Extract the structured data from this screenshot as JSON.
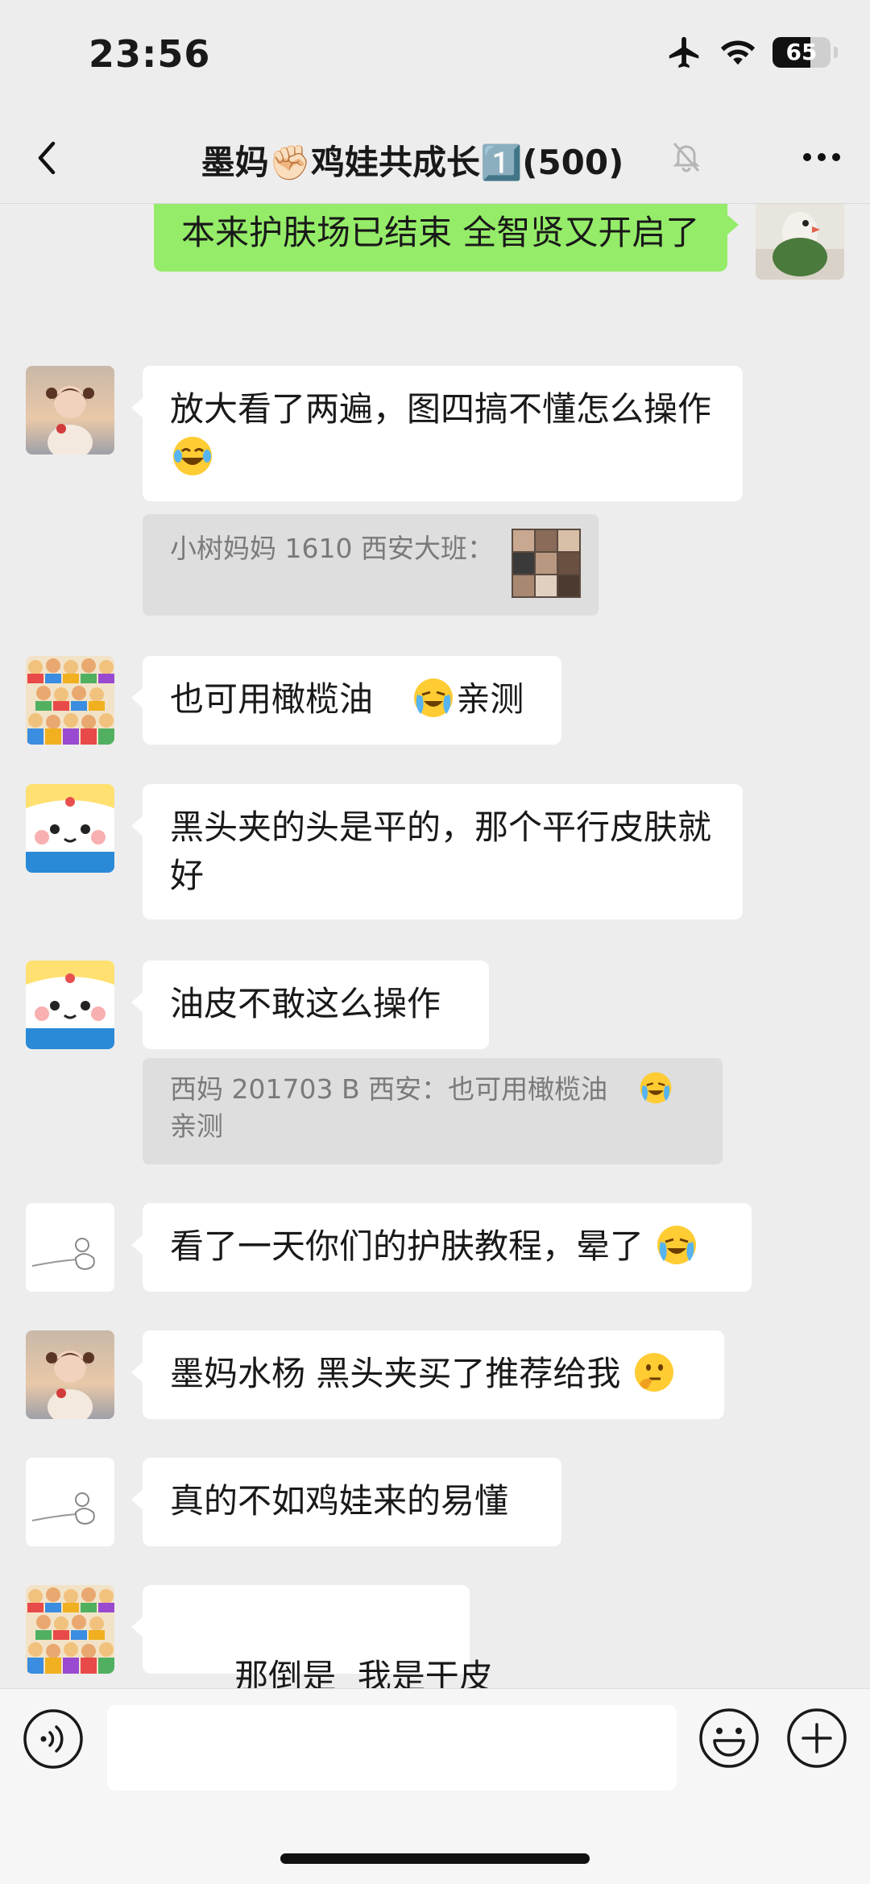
{
  "status_bar": {
    "time": "23:56",
    "battery_percent": "65"
  },
  "nav": {
    "title": "墨妈✊🏻鸡娃共成长1️⃣(500)",
    "back_icon": "chevron-left-icon",
    "more_icon": "more-icon"
  },
  "messages": [
    {
      "side": "right",
      "text": "本来护肤场已结束 全智贤又开启了"
    },
    {
      "side": "left",
      "avatar": "girl-photo",
      "text": "放大看了两遍，图四搞不懂怎么操作",
      "emoji": "laughing-tears-emoji"
    },
    {
      "type": "quote",
      "text": "小树妈妈 1610 西安大班："
    },
    {
      "side": "left",
      "avatar": "crowd-cartoon",
      "text_before": "也可用橄榄油",
      "emoji": "crying-laughing-emoji",
      "text_after": "亲测"
    },
    {
      "side": "left",
      "avatar": "cartoon-face",
      "text": "黑头夹的头是平的，那个平行皮肤就好"
    },
    {
      "side": "left",
      "avatar": "cartoon-face",
      "text": "油皮不敢这么操作"
    },
    {
      "type": "quote",
      "text_line1": "西妈 201703 B 西安：也可用橄榄油",
      "text_line2": "亲测"
    },
    {
      "side": "left",
      "avatar": "sketch",
      "text": "看了一天你们的护肤教程，晕了"
    },
    {
      "side": "left",
      "avatar": "girl-photo",
      "text": "墨妈水杨 黑头夹买了推荐给我"
    },
    {
      "side": "left",
      "avatar": "sketch",
      "text": "真的不如鸡娃来的易懂"
    },
    {
      "side": "left",
      "avatar": "crowd-cartoon",
      "text": "那倒是  我是干皮"
    }
  ],
  "input_bar": {
    "voice_icon": "voice-icon",
    "emoji_icon": "emoji-icon",
    "plus_icon": "plus-icon",
    "input_value": ""
  }
}
